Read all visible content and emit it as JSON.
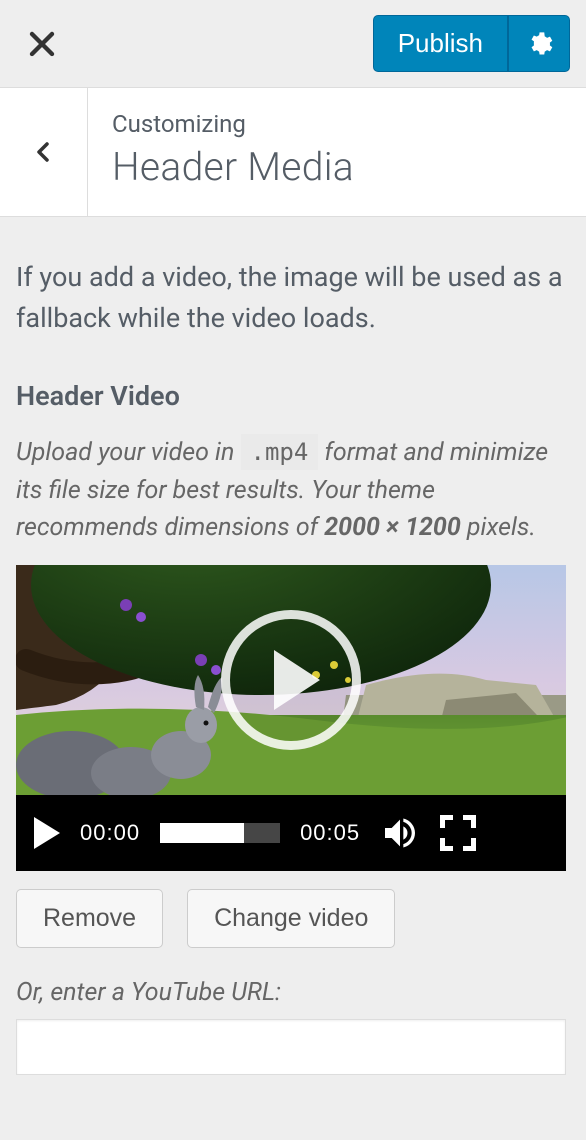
{
  "topbar": {
    "publish_label": "Publish"
  },
  "header": {
    "eyebrow": "Customizing",
    "title": "Header Media"
  },
  "intro": "If you add a video, the image will be used as a fallback while the video loads.",
  "video_section": {
    "heading": "Header Video",
    "hint_prefix": "Upload your video in ",
    "hint_code": ".mp4",
    "hint_mid": " format and minimize its file size for best results. Your theme recommends dimensions of ",
    "hint_dims": "2000 × 1200",
    "hint_suffix": " pixels.",
    "current_time": "00:00",
    "duration": "00:05",
    "remove_label": "Remove",
    "change_label": "Change video"
  },
  "youtube": {
    "label": "Or, enter a YouTube URL:",
    "value": ""
  }
}
